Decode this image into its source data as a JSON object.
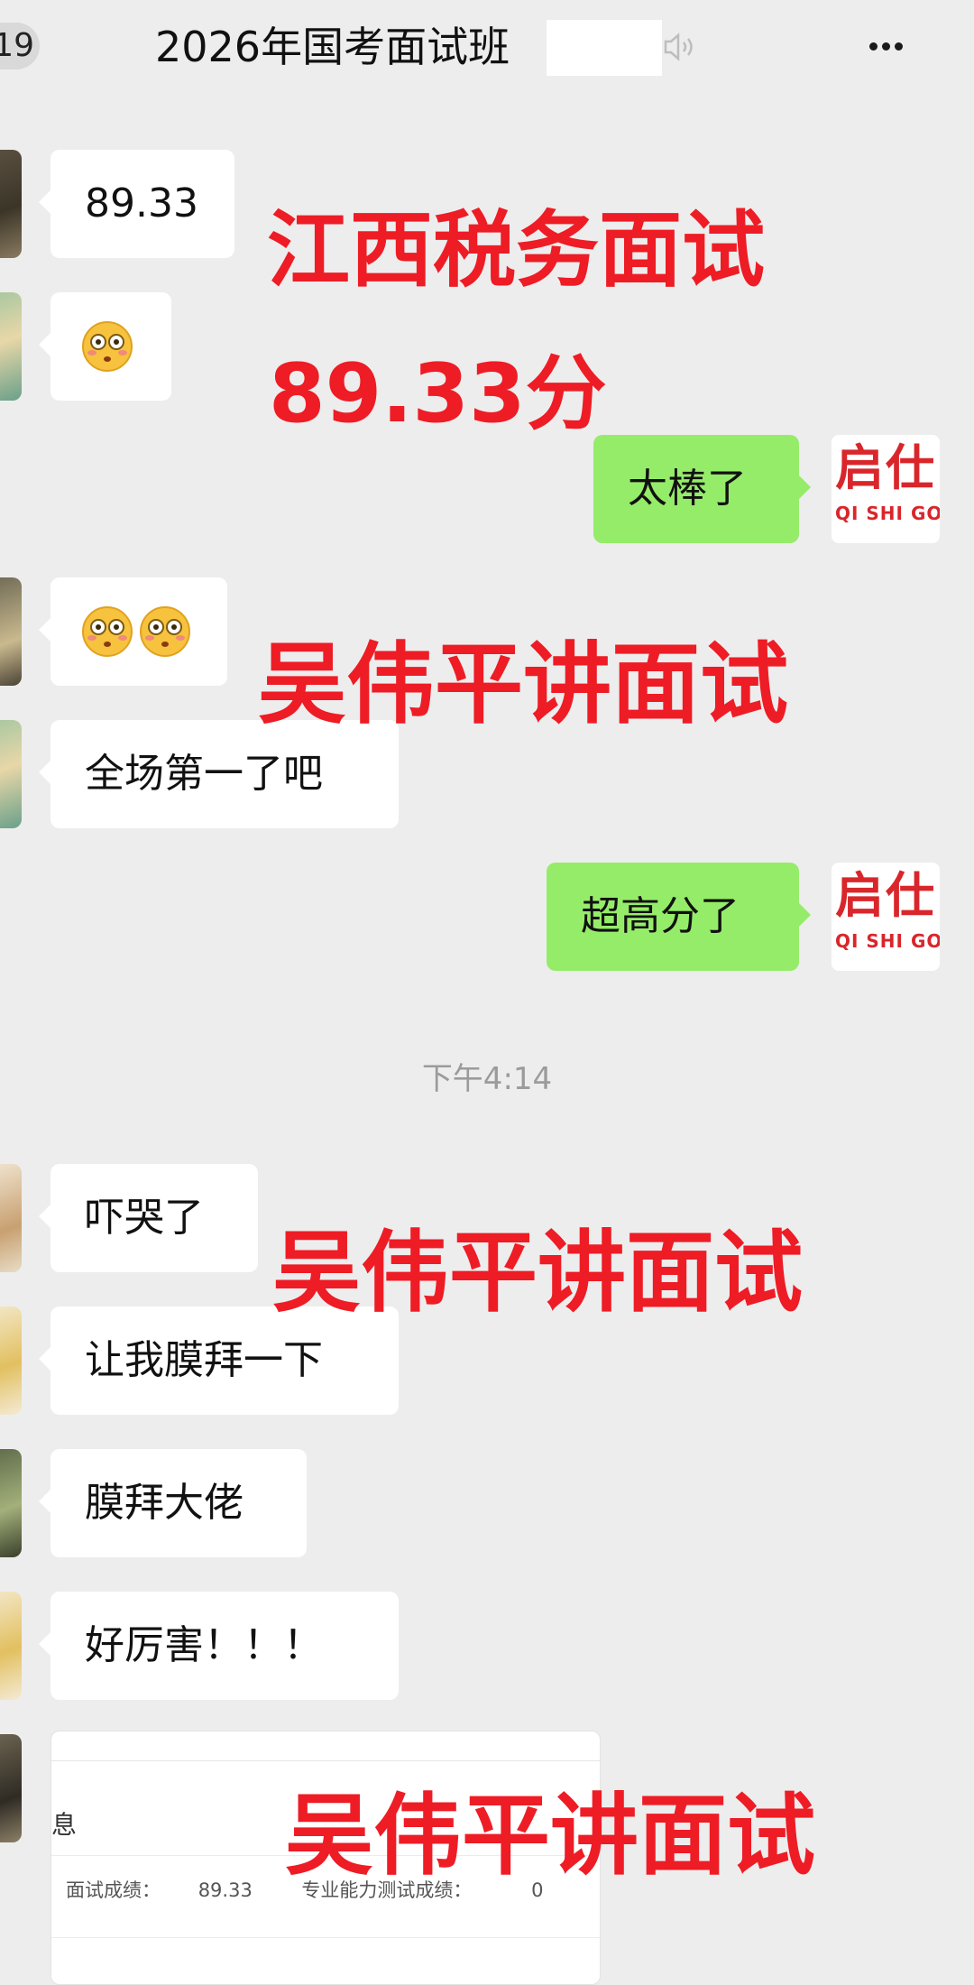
{
  "header": {
    "back_count": "19",
    "title": "2026年国考面试班"
  },
  "messages": [
    {
      "side": "left",
      "text": "89.33"
    },
    {
      "side": "left",
      "emoji": "flushed-face"
    },
    {
      "side": "right",
      "text": "太棒了",
      "sender_logo": "启仕"
    },
    {
      "side": "left",
      "emoji": "flushed-face-x2"
    },
    {
      "side": "left",
      "text": "全场第一了吧"
    },
    {
      "side": "right",
      "text": "超高分了",
      "sender_logo": "启仕"
    },
    {
      "side": "left",
      "text": "吓哭了"
    },
    {
      "side": "left",
      "text": "让我膜拜一下"
    },
    {
      "side": "left",
      "text": "膜拜大佬"
    },
    {
      "side": "left",
      "text": "好厉害！！！"
    }
  ],
  "logo": {
    "cn": "启仕",
    "en": "QI SHI GO"
  },
  "timestamp": "下午4:14",
  "overlays": [
    "江西税务面试",
    "89.33分",
    "吴伟平讲面试",
    "吴伟平讲面试",
    "吴伟平讲面试"
  ],
  "card": {
    "heading": "息",
    "score_label": "面试成绩：",
    "score_value": "89.33",
    "test_label": "专业能力测试成绩：",
    "test_value": "0"
  },
  "colors": {
    "background": "#ededed",
    "sent_bubble": "#95ec69",
    "received_bubble": "#ffffff",
    "overlay_red": "#ee1c25",
    "logo_red": "#d9262b"
  }
}
